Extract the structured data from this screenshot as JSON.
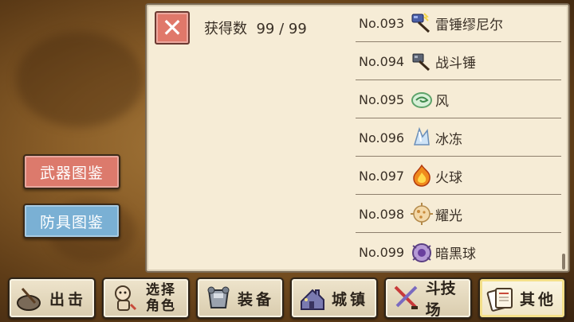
{
  "side_buttons": {
    "weapon_dex": "武器图鉴",
    "armor_dex": "防具图鉴"
  },
  "panel": {
    "close_symbol": "✕",
    "obtained_label": "获得数",
    "obtained_count": "99 / 99",
    "items": [
      {
        "no": "No.093",
        "name": "雷锤缪尼尔",
        "icon": "thunder-hammer-icon"
      },
      {
        "no": "No.094",
        "name": "战斗锤",
        "icon": "war-hammer-icon"
      },
      {
        "no": "No.095",
        "name": "风",
        "icon": "wind-icon"
      },
      {
        "no": "No.096",
        "name": "冰冻",
        "icon": "ice-icon"
      },
      {
        "no": "No.097",
        "name": "火球",
        "icon": "fireball-icon"
      },
      {
        "no": "No.098",
        "name": "耀光",
        "icon": "radiance-icon"
      },
      {
        "no": "No.099",
        "name": "暗黑球",
        "icon": "dark-orb-icon"
      }
    ]
  },
  "nav": {
    "sortie": "出击",
    "select_role_line1": "选择",
    "select_role_line2": "角色",
    "equip": "装备",
    "town": "城镇",
    "arena": "斗技场",
    "other": "其他"
  },
  "colors": {
    "weapon_button": "#dc7a6c",
    "armor_button": "#7ab0d4",
    "panel_bg": "#f6ecd6",
    "close_button": "#e0786a"
  }
}
